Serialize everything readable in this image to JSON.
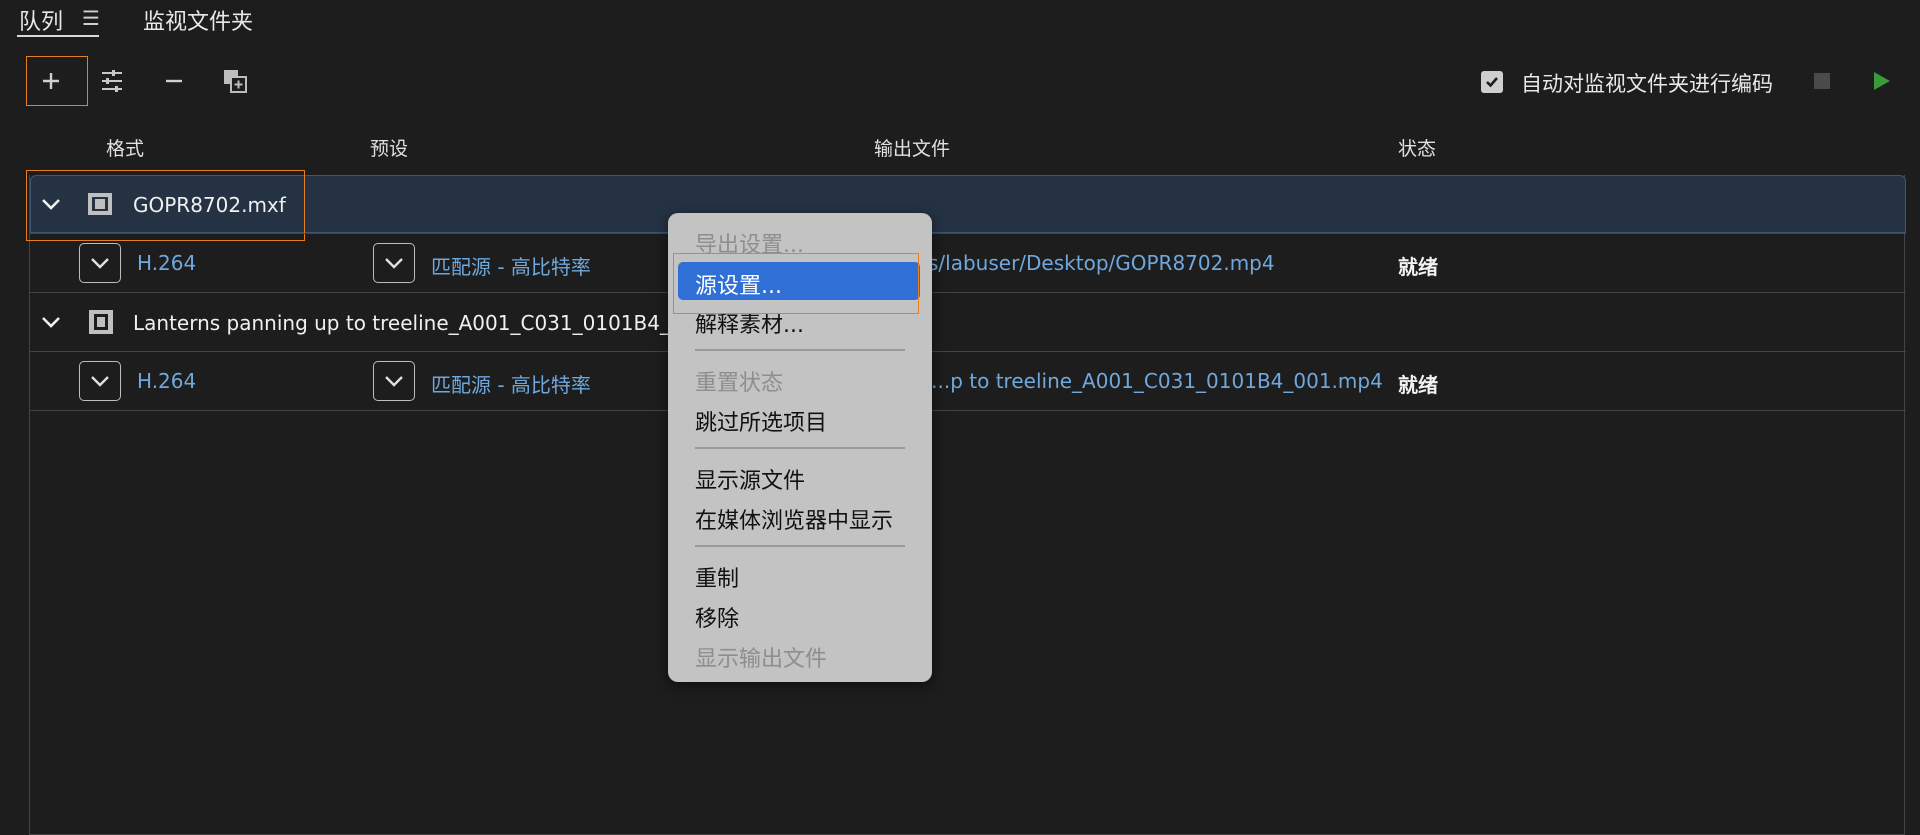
{
  "tabs": {
    "queue": "队列",
    "menu_glyph": "☰",
    "watch": "监视文件夹"
  },
  "toolbar": {
    "auto_encode_label": "自动对监视文件夹进行编码",
    "auto_encode_checked": true,
    "play_color": "#3a9a3a"
  },
  "columns": {
    "format": "格式",
    "preset": "预设",
    "output": "输出文件",
    "status": "状态"
  },
  "items": [
    {
      "name": "GOPR8702.mxf",
      "format": "H.264",
      "preset": "匹配源 - 高比特率",
      "output": "s/labuser/Desktop/GOPR8702.mp4",
      "status": "就绪"
    },
    {
      "name": "Lanterns panning up to treeline_A001_C031_0101B4_001",
      "format": "H.264",
      "preset": "匹配源 - 高比特率",
      "output": "s/...p to treeline_A001_C031_0101B4_001.mp4",
      "status": "就绪"
    }
  ],
  "context_menu": {
    "export_settings": "导出设置...",
    "source_settings": "源设置...",
    "interpret_footage": "解释素材...",
    "reset_status": "重置状态",
    "skip_selected": "跳过所选项目",
    "reveal_source": "显示源文件",
    "reveal_in_media_browser": "在媒体浏览器中显示",
    "duplicate": "重制",
    "remove": "移除",
    "reveal_output": "显示输出文件"
  },
  "colors": {
    "accent_highlight": "#e67e22",
    "link": "#6fa8dc",
    "menu_active": "#2f6fd6"
  }
}
